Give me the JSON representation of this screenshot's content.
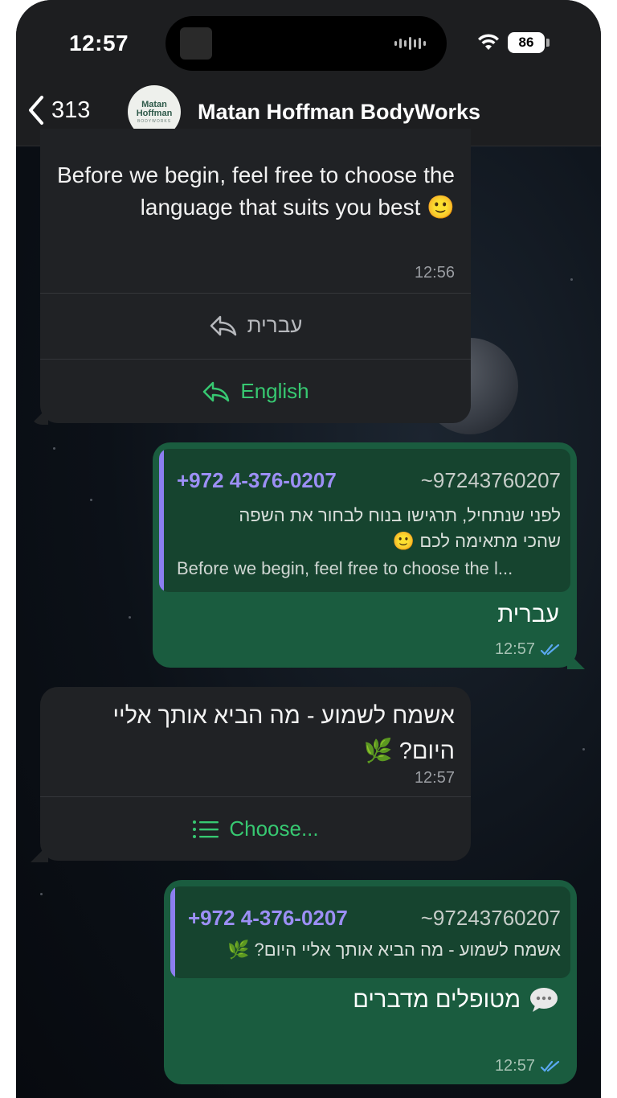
{
  "status_bar": {
    "time": "12:57",
    "battery": "86"
  },
  "header": {
    "back_count": "313",
    "contact_name": "Matan Hoffman BodyWorks",
    "avatar_line1": "Matan",
    "avatar_line2": "Hoffman",
    "avatar_line3": "BODYWORKS"
  },
  "messages": [
    {
      "direction": "incoming",
      "text": "Before we begin, feel free to choose the language that suits you best 🙂",
      "time": "12:56",
      "buttons": [
        "עברית",
        "English"
      ]
    },
    {
      "direction": "outgoing",
      "quote": {
        "phone": "+972 4-376-0207",
        "alias": "~97243760207",
        "line1": "לפני שנתחיל, תרגישו בנוח לבחור את השפה",
        "line2": "שהכי מתאימה לכם 🙂",
        "line3": "Before we begin, feel free to choose the l..."
      },
      "text": "עברית",
      "time": "12:57"
    },
    {
      "direction": "incoming",
      "line1": "אשמח לשמוע - מה הביא אותך אליי",
      "line2": "היום? 🌿",
      "time": "12:57",
      "button": "Choose..."
    },
    {
      "direction": "outgoing",
      "quote": {
        "phone": "+972 4-376-0207",
        "alias": "~97243760207",
        "line1": "אשמח לשמוע - מה הביא אותך אליי היום? 🌿"
      },
      "text": "מטופלים מדברים",
      "time": "12:57"
    }
  ],
  "colors": {
    "incoming_bubble": "#202225",
    "outgoing_bubble": "#1a5c3f",
    "accent_green": "#37c871",
    "quote_purple": "#8c7ef0"
  }
}
